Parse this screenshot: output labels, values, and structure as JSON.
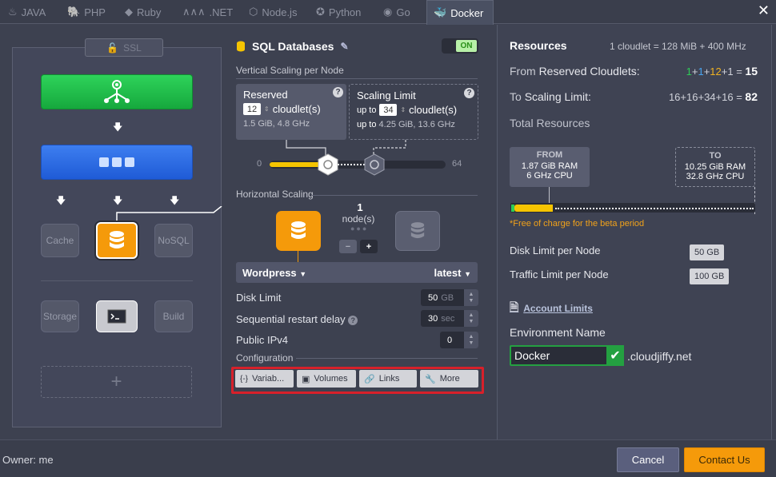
{
  "tabs": [
    {
      "label": "JAVA",
      "icon": "java-icon"
    },
    {
      "label": "PHP",
      "icon": "php-icon"
    },
    {
      "label": "Ruby",
      "icon": "ruby-icon"
    },
    {
      "label": ".NET",
      "icon": "dotnet-icon"
    },
    {
      "label": "Node.js",
      "icon": "nodejs-icon"
    },
    {
      "label": "Python",
      "icon": "python-icon"
    },
    {
      "label": "Go",
      "icon": "go-icon"
    },
    {
      "label": "Docker",
      "icon": "docker-icon",
      "active": true
    }
  ],
  "topology": {
    "ssl_label": "SSL",
    "cache_label": "Cache",
    "nosql_label": "NoSQL",
    "storage_label": "Storage",
    "build_label": "Build",
    "add_symbol": "+"
  },
  "node": {
    "title": "SQL Databases",
    "toggle": "ON",
    "vertical_label": "Vertical Scaling per Node",
    "reserved": {
      "title": "Reserved",
      "value": "12",
      "unit": "cloudlet(s)",
      "sub": "1.5 GiB, 4.8 GHz"
    },
    "limit": {
      "title": "Scaling Limit",
      "prefix": "up to",
      "value": "34",
      "unit": "cloudlet(s)",
      "sub_prefix": "up to",
      "sub": "4.25 GiB, 13.6 GHz"
    },
    "slider_min": "0",
    "slider_max": "64",
    "horizontal_label": "Horizontal Scaling",
    "node_count": "1",
    "node_unit": "node(s)",
    "image": "Wordpress",
    "tag": "latest",
    "disk_limit_label": "Disk Limit",
    "disk_limit_value": "50",
    "disk_limit_unit": "GB",
    "restart_label": "Sequential restart delay",
    "restart_value": "30",
    "restart_unit": "sec",
    "ipv4_label": "Public IPv4",
    "ipv4_value": "0",
    "config_label": "Configuration",
    "config_buttons": [
      "Variab...",
      "Volumes",
      "Links",
      "More"
    ]
  },
  "resources": {
    "title": "Resources",
    "cloudlet_def": "1 cloudlet = 128 MiB + 400 MHz",
    "from_prefix": "From",
    "from_label": "Reserved Cloudlets:",
    "from_terms": [
      "1",
      "1",
      "12",
      "1"
    ],
    "from_total": "15",
    "to_prefix": "To",
    "to_label": "Scaling Limit:",
    "to_terms": [
      "16",
      "16",
      "34",
      "16"
    ],
    "to_total": "82",
    "total_label": "Total Resources",
    "from_tag": {
      "title": "FROM",
      "ram": "1.87 GiB RAM",
      "cpu": "6 GHz CPU"
    },
    "to_tag": {
      "title": "TO",
      "ram": "10.25 GiB RAM",
      "cpu": "32.8 GHz CPU"
    },
    "beta_note": "*Free of charge for the beta period",
    "disk_label": "Disk Limit per Node",
    "disk_value": "50 GB",
    "traffic_label": "Traffic Limit per Node",
    "traffic_value": "100 GB",
    "account_limits": "Account Limits",
    "env_label": "Environment Name",
    "env_value": "Docker",
    "env_domain": ".cloudjiffy.net"
  },
  "footer": {
    "owner": "Owner: me",
    "cancel": "Cancel",
    "contact": "Contact Us"
  },
  "colors": {
    "accent": "#f59a0a",
    "green_node": "#16a83d",
    "blue_node": "#1f5bd6",
    "highlight": "#d7202a"
  }
}
